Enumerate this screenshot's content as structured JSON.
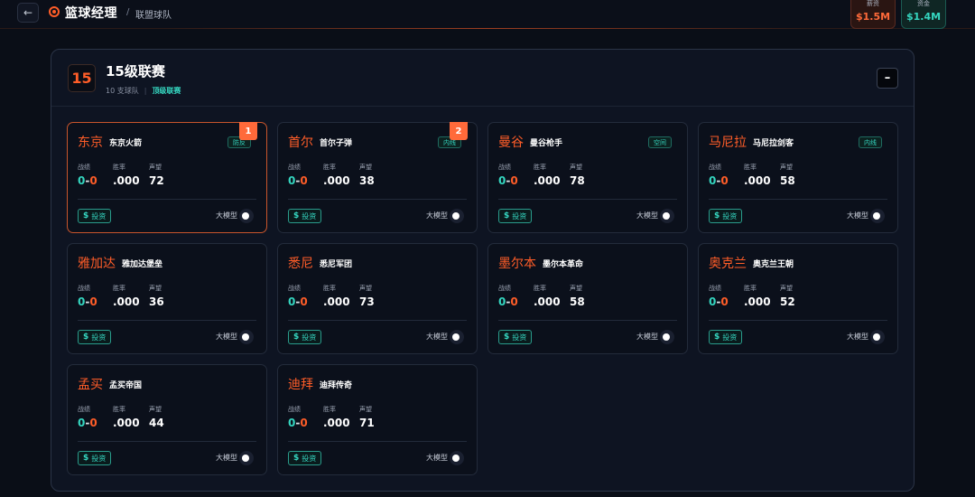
{
  "header": {
    "back_icon": "arrow-left-icon",
    "logo_icon": "target-icon",
    "app_title": "篮球经理",
    "breadcrumb_sep": "/",
    "breadcrumb": "联盟球队",
    "budget_label": "薪资",
    "budget_value": "$1.5M",
    "funds_label": "资金",
    "funds_value": "$1.4M",
    "colors": {
      "accent": "#ff5d28",
      "teal": "#35d6c0"
    }
  },
  "league": {
    "tier": "15",
    "name": "15级联赛",
    "team_count": "10 支球队",
    "sep": "|",
    "tag": "顶级联赛",
    "collapse_label": "–"
  },
  "labels": {
    "record": "战绩",
    "win_rate": "胜率",
    "reputation": "声望",
    "invest": "投资",
    "invest_icon": "$",
    "model": "大模型"
  },
  "teams": [
    {
      "city": "东京",
      "name": "东京火箭",
      "status": "防反",
      "rank": "1",
      "wins": "0",
      "dash": "-",
      "losses": "0",
      "win_rate": ".000",
      "reputation": "72"
    },
    {
      "city": "首尔",
      "name": "首尔子弹",
      "status": "内线",
      "rank": "2",
      "wins": "0",
      "dash": "-",
      "losses": "0",
      "win_rate": ".000",
      "reputation": "38"
    },
    {
      "city": "曼谷",
      "name": "曼谷枪手",
      "status": "空间",
      "rank": "",
      "wins": "0",
      "dash": "-",
      "losses": "0",
      "win_rate": ".000",
      "reputation": "78"
    },
    {
      "city": "马尼拉",
      "name": "马尼拉剑客",
      "status": "内线",
      "rank": "",
      "wins": "0",
      "dash": "-",
      "losses": "0",
      "win_rate": ".000",
      "reputation": "58"
    },
    {
      "city": "雅加达",
      "name": "雅加达堡垒",
      "status": "",
      "rank": "",
      "wins": "0",
      "dash": "-",
      "losses": "0",
      "win_rate": ".000",
      "reputation": "36"
    },
    {
      "city": "悉尼",
      "name": "悉尼军团",
      "status": "",
      "rank": "",
      "wins": "0",
      "dash": "-",
      "losses": "0",
      "win_rate": ".000",
      "reputation": "73"
    },
    {
      "city": "墨尔本",
      "name": "墨尔本革命",
      "status": "",
      "rank": "",
      "wins": "0",
      "dash": "-",
      "losses": "0",
      "win_rate": ".000",
      "reputation": "58"
    },
    {
      "city": "奥克兰",
      "name": "奥克兰王朝",
      "status": "",
      "rank": "",
      "wins": "0",
      "dash": "-",
      "losses": "0",
      "win_rate": ".000",
      "reputation": "52"
    },
    {
      "city": "孟买",
      "name": "孟买帝国",
      "status": "",
      "rank": "",
      "wins": "0",
      "dash": "-",
      "losses": "0",
      "win_rate": ".000",
      "reputation": "44"
    },
    {
      "city": "迪拜",
      "name": "迪拜传奇",
      "status": "",
      "rank": "",
      "wins": "0",
      "dash": "-",
      "losses": "0",
      "win_rate": ".000",
      "reputation": "71"
    }
  ]
}
